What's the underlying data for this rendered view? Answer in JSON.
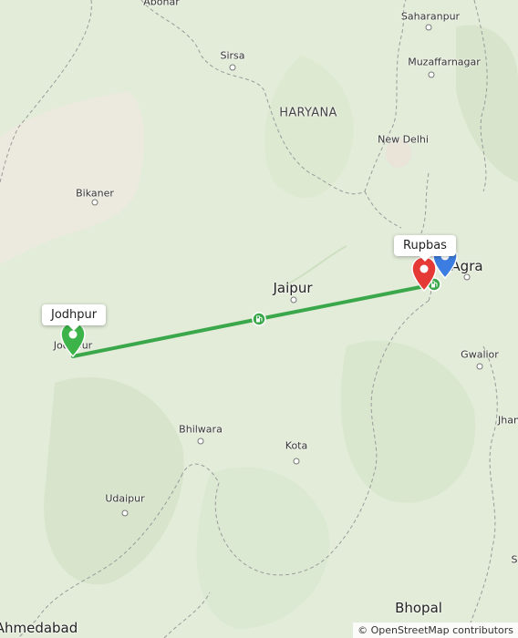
{
  "map": {
    "places": {
      "abohar": "Abohar",
      "saharanpur": "Saharanpur",
      "sirsa": "Sirsa",
      "muzaffarnagar": "Muzaffarnagar",
      "haryana": "HARYANA",
      "new_delhi": "New Delhi",
      "bikaner": "Bikaner",
      "agra": "Agra",
      "jaipur": "Jaipur",
      "jodhpur": "Jodhpur",
      "gwalior": "Gwalior",
      "jhansi": "Jhan",
      "bhilwara": "Bhilwara",
      "kota": "Kota",
      "udaipur": "Udaipur",
      "bhopal": "Bhopal",
      "ahmedabad": "Ahmedabad",
      "s_partial": "S"
    },
    "callouts": {
      "start": "Jodhpur",
      "end": "Rupbas"
    },
    "markers": {
      "start_color": "#3db44a",
      "end_color": "#e53935",
      "extra_color": "#3b7de0",
      "route_color": "#3aa84a"
    },
    "attribution": "© OpenStreetMap contributors"
  }
}
